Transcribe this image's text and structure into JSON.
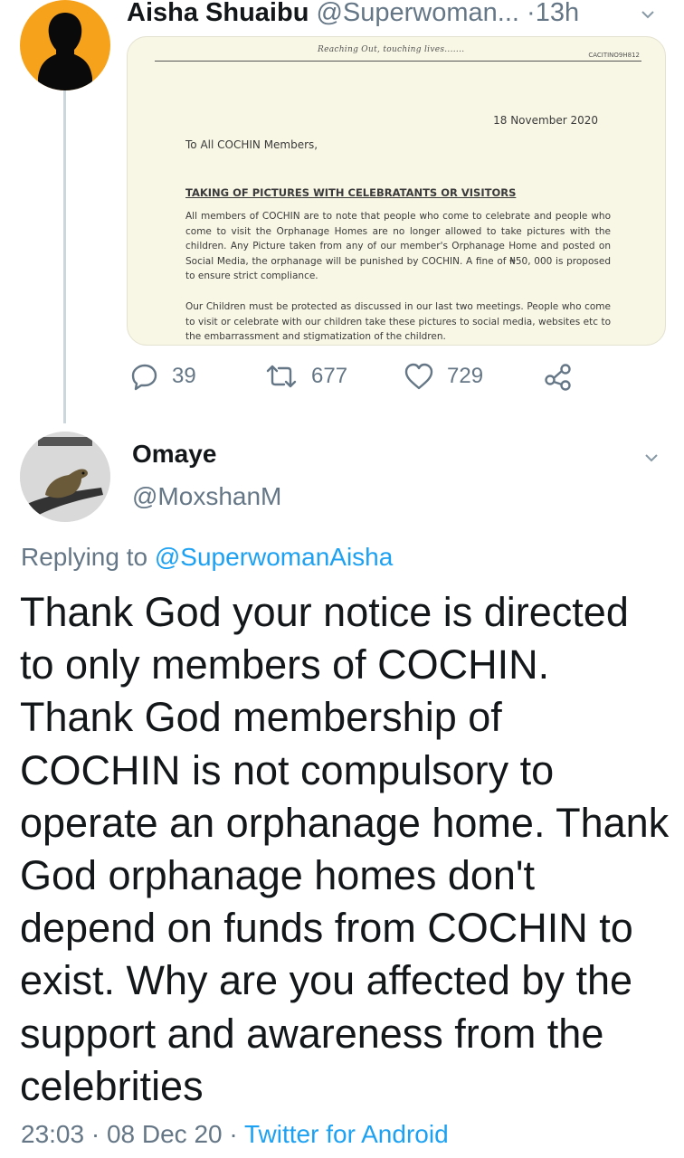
{
  "colors": {
    "text_primary": "#14171a",
    "text_secondary": "#657786",
    "link": "#1da1f2",
    "avatar_bg": "#f7a21b",
    "thread_line": "#ccd6dd"
  },
  "tweet1": {
    "name": "Aisha Shuaibu",
    "handle": "@Superwoman...",
    "separator": "·",
    "time": "13h",
    "media": {
      "motto": "Reaching Out, touching lives.......",
      "reference": "CACITINO9H812",
      "date": "18 November 2020",
      "greeting": "To All COCHIN Members,",
      "subject": "TAKING OF PICTURES WITH CELEBRATANTS OR VISITORS",
      "paragraph1": "All members of COCHIN are to note that people who come to celebrate and people who come to visit the Orphanage Homes are no longer allowed to take pictures with the children. Any Picture taken from any of our member's Orphanage Home and posted on Social Media, the orphanage will be punished by COCHIN. A fine of ₦50, 000 is proposed to ensure strict compliance.",
      "paragraph2": "Our Children must be protected as discussed in our last two meetings. People who come to visit or celebrate with our children take these pictures to social media, websites etc to the embarrassment and stigmatization of the children."
    },
    "actions": {
      "replies": "39",
      "retweets": "677",
      "likes": "729"
    },
    "icons": [
      "reply-icon",
      "retweet-icon",
      "like-icon",
      "share-icon",
      "chevron-down-icon"
    ]
  },
  "tweet2": {
    "name": "Omaye",
    "handle": "@MoxshanM",
    "replying_prefix": "Replying to",
    "replying_to": "@SuperwomanAisha",
    "text": "Thank God your notice is directed to only members of COCHIN. Thank God membership of COCHIN is not compulsory to operate an orphanage home. Thank God orphanage homes don't depend on funds from COCHIN to exist. Why are you affected by the support and awareness from the celebrities",
    "timestamp": "23:03 · 08 Dec 20 ·",
    "source": "Twitter for Android"
  }
}
